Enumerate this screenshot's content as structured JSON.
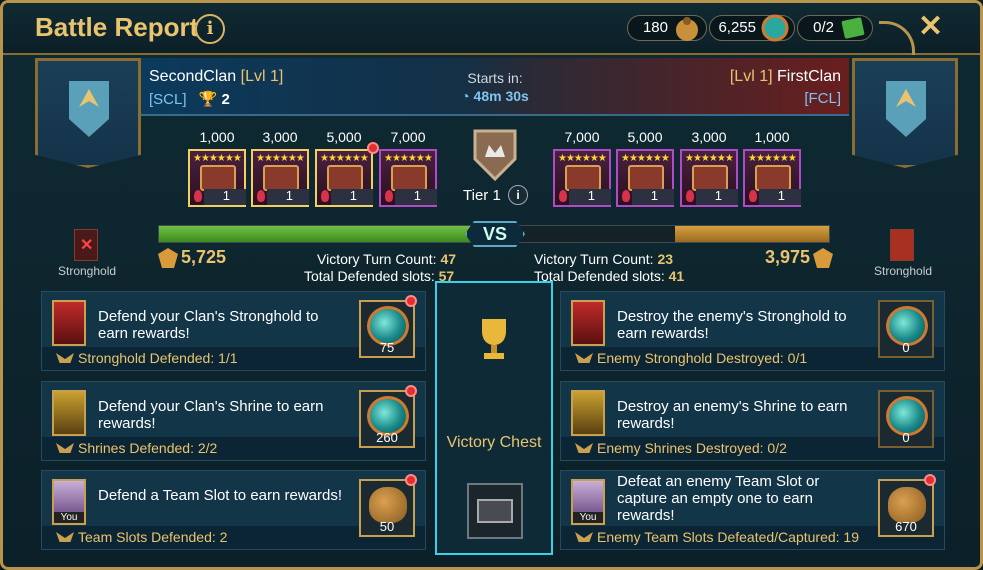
{
  "header": {
    "title": "Battle Report",
    "info_glyph": "i",
    "resources": [
      {
        "value": "180",
        "icon": "gold-bag-icon"
      },
      {
        "value": "6,255",
        "icon": "gem-orb-icon"
      },
      {
        "value": "0/2",
        "icon": "ticket-icon"
      }
    ],
    "close_glyph": "✕"
  },
  "left_clan": {
    "name": "SecondClan",
    "level": "[Lvl 1]",
    "tag": "[SCL]",
    "trophies": "2",
    "score": "5,725",
    "stronghold_label": "Stronghold"
  },
  "right_clan": {
    "name": "FirstClan",
    "level": "[Lvl 1]",
    "tag": "[FCL]",
    "score": "3,975",
    "stronghold_label": "Stronghold"
  },
  "timer": {
    "label": "Starts in:",
    "value": "48m 30s"
  },
  "tier": {
    "label": "Tier 1",
    "info_glyph": "i"
  },
  "left_chests": [
    {
      "value": "1,000",
      "count": "1",
      "stars": "★★★★★★",
      "highlight": true,
      "dot": false
    },
    {
      "value": "3,000",
      "count": "1",
      "stars": "★★★★★★",
      "highlight": true,
      "dot": false
    },
    {
      "value": "5,000",
      "count": "1",
      "stars": "★★★★★★",
      "highlight": true,
      "dot": true
    },
    {
      "value": "7,000",
      "count": "1",
      "stars": "★★★★★★",
      "highlight": false,
      "dot": false
    }
  ],
  "right_chests": [
    {
      "value": "7,000",
      "count": "1",
      "stars": "★★★★★★"
    },
    {
      "value": "5,000",
      "count": "1",
      "stars": "★★★★★★"
    },
    {
      "value": "3,000",
      "count": "1",
      "stars": "★★★★★★"
    },
    {
      "value": "1,000",
      "count": "1",
      "stars": "★★★★★★"
    }
  ],
  "progress": {
    "left_fraction": 0.48,
    "right_fraction": 0.23,
    "vs_label": "VS"
  },
  "left_stats": {
    "turn_label": "Victory Turn Count:",
    "turn_value": "47",
    "slots_label": "Total Defended slots:",
    "slots_value": "57"
  },
  "right_stats": {
    "turn_label": "Victory Turn Count:",
    "turn_value": "23",
    "slots_label": "Total Defended slots:",
    "slots_value": "41"
  },
  "left_quests": [
    {
      "text": "Defend your Clan's Stronghold to earn rewards!",
      "status": "Stronghold Defended: 1/1",
      "reward": "75",
      "reward_type": "orb",
      "dot": true,
      "icon": "red"
    },
    {
      "text": "Defend your Clan's Shrine to earn rewards!",
      "status": "Shrines Defended: 2/2",
      "reward": "260",
      "reward_type": "orb",
      "dot": true,
      "icon": "gold"
    },
    {
      "text": "Defend a Team Slot to earn rewards!",
      "status": "Team Slots Defended: 2",
      "reward": "50",
      "reward_type": "bag",
      "dot": true,
      "icon": "you",
      "icon_label": "You"
    }
  ],
  "right_quests": [
    {
      "text": "Destroy the enemy's Stronghold to earn rewards!",
      "status": "Enemy Stronghold Destroyed: 0/1",
      "reward": "0",
      "reward_type": "orb",
      "dot": false,
      "icon": "red"
    },
    {
      "text": "Destroy an enemy's Shrine to earn rewards!",
      "status": "Enemy Shrines Destroyed: 0/2",
      "reward": "0",
      "reward_type": "orb",
      "dot": false,
      "icon": "gold"
    },
    {
      "text": "Defeat an enemy Team Slot or capture an empty one to earn rewards!",
      "status": "Enemy Team Slots Defeated/Captured: 19",
      "reward": "670",
      "reward_type": "bag",
      "dot": true,
      "icon": "you",
      "icon_label": "You"
    }
  ],
  "center": {
    "label": "Victory Chest"
  }
}
